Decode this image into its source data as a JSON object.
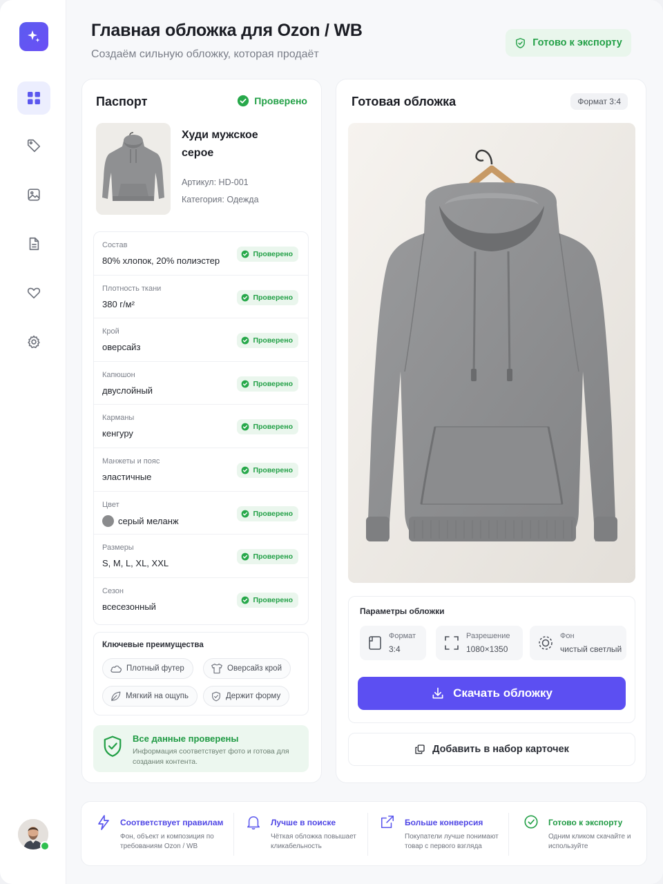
{
  "header": {
    "title": "Главная обложка для Ozon / WB",
    "subtitle": "Создаём сильную обложку, которая продаёт",
    "export_status": "Готово к экспорту"
  },
  "sidebar": {
    "items": [
      {
        "icon": "grid-icon",
        "active": true
      },
      {
        "icon": "tag-icon",
        "active": false
      },
      {
        "icon": "image-icon",
        "active": false
      },
      {
        "icon": "document-icon",
        "active": false
      },
      {
        "icon": "heart-icon",
        "active": false
      },
      {
        "icon": "gear-icon",
        "active": false
      }
    ],
    "user_online": true
  },
  "passport": {
    "title": "Паспорт",
    "status": "Проверено",
    "product": {
      "name": "Худи мужское серое",
      "sku": "Артикул: HD-001",
      "category": "Категория: Одежда"
    },
    "specs": [
      {
        "label": "Состав",
        "value": "80% хлопок, 20% полиэстер",
        "status": "Проверено"
      },
      {
        "label": "Плотность ткани",
        "value": "380 г/м²",
        "status": "Проверено"
      },
      {
        "label": "Крой",
        "value": "оверсайз",
        "status": "Проверено"
      },
      {
        "label": "Капюшон",
        "value": "двуслойный",
        "status": "Проверено"
      },
      {
        "label": "Карманы",
        "value": "кенгуру",
        "status": "Проверено"
      },
      {
        "label": "Манжеты и пояс",
        "value": "эластичные",
        "status": "Проверено"
      },
      {
        "label": "Цвет",
        "value": "серый меланж",
        "status": "Проверено",
        "swatch": "#8a8b8d"
      },
      {
        "label": "Размеры",
        "value": "S, M, L, XL, XXL",
        "status": "Проверено"
      },
      {
        "label": "Сезон",
        "value": "всесезонный",
        "status": "Проверено"
      }
    ],
    "benefits": {
      "title": "Ключевые преимущества",
      "items": [
        {
          "label": "Плотный футер",
          "icon": "cloud-icon"
        },
        {
          "label": "Оверсайз крой",
          "icon": "tshirt-icon"
        },
        {
          "label": "Мягкий на ощупь",
          "icon": "leaf-icon"
        },
        {
          "label": "Держит форму",
          "icon": "shield-icon"
        }
      ]
    },
    "verified_box": {
      "title": "Все данные проверены",
      "text": "Информация соответствует фото и готова для создания контента."
    }
  },
  "cover": {
    "title": "Готовая обложка",
    "format_badge": "Формат 3:4",
    "params": {
      "title": "Параметры обложки",
      "items": [
        {
          "label": "Формат",
          "value": "3:4",
          "icon": "format-icon"
        },
        {
          "label": "Разрешение",
          "value": "1080×1350",
          "icon": "resize-icon"
        },
        {
          "label": "Фон",
          "value": "чистый светлый",
          "icon": "background-icon"
        }
      ]
    },
    "download_label": "Скачать обложку",
    "add_label": "Добавить в набор карточек"
  },
  "features": [
    {
      "title": "Соответствует правилам",
      "text": "Фон, объект и композиция по требованиям Ozon / WB",
      "icon": "sparkle-icon"
    },
    {
      "title": "Лучше в поиске",
      "text": "Чёткая обложка повышает кликабельность",
      "icon": "bell-icon"
    },
    {
      "title": "Больше конверсия",
      "text": "Покупатели лучше понимают товар с первого взгляда",
      "icon": "share-icon"
    },
    {
      "title": "Готово к экспорту",
      "text": "Одним кликом скачайте и используйте",
      "icon": "check-circle-icon"
    }
  ],
  "colors": {
    "accent": "#5c4ff2",
    "success": "#23a047",
    "success_bg": "#eaf6ed"
  }
}
